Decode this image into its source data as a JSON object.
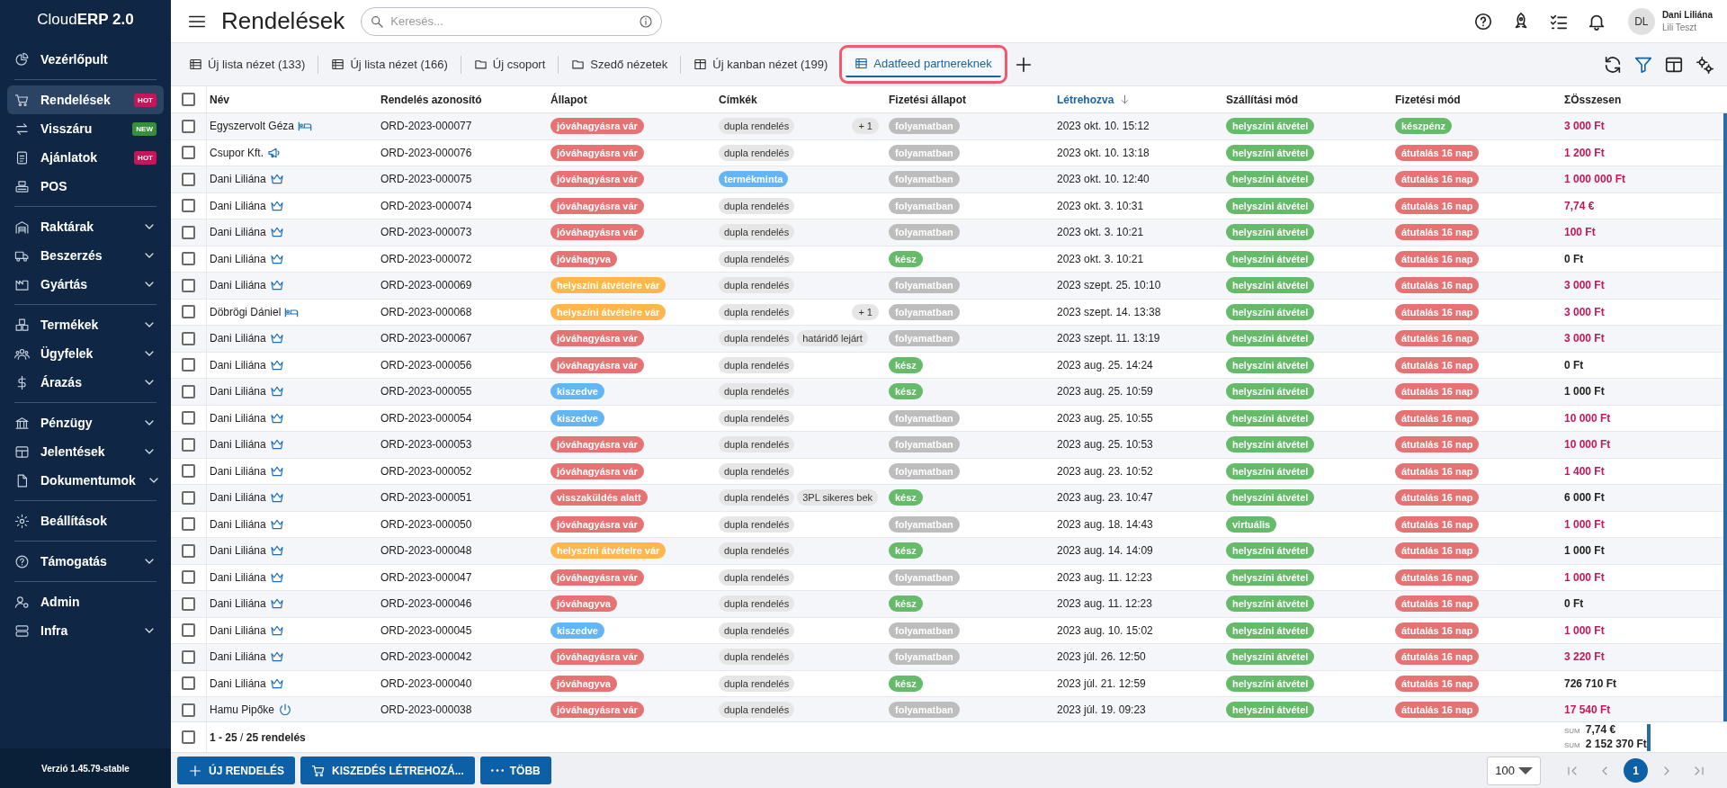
{
  "sidebar": {
    "logo": "Cloud**ERP 2.0**",
    "sections": [
      [
        {
          "label": "Vezérlőpult",
          "selected": false
        }
      ],
      [
        {
          "label": "Rendelések",
          "selected": true,
          "badge": {
            "text": "HOT",
            "color": "#c2185b"
          }
        },
        {
          "label": "Visszáru",
          "selected": false,
          "badge": {
            "text": "NEW",
            "color": "#388e3c"
          }
        },
        {
          "label": "Ajánlatok",
          "selected": false,
          "badge": {
            "text": "HOT",
            "color": "#c2185b"
          }
        },
        {
          "label": "POS",
          "selected": false
        }
      ],
      [
        {
          "label": "Raktárak",
          "selected": false,
          "expanded": false
        },
        {
          "label": "Beszerzés",
          "selected": false,
          "expanded": false
        },
        {
          "label": "Gyártás",
          "selected": false,
          "expanded": false
        }
      ],
      [
        {
          "label": "Termékek",
          "selected": false,
          "expanded": false
        },
        {
          "label": "Ügyfelek",
          "selected": false,
          "expanded": false
        },
        {
          "label": "Árazás",
          "selected": false,
          "expanded": false
        }
      ],
      [
        {
          "label": "Pénzügy",
          "selected": false,
          "expanded": false
        },
        {
          "label": "Jelentések",
          "selected": false,
          "expanded": false
        },
        {
          "label": "Dokumentumok",
          "selected": false,
          "expanded": false
        }
      ],
      [
        {
          "label": "Beállítások",
          "selected": false
        }
      ],
      [
        {
          "label": "Támogatás",
          "selected": false,
          "expanded": false
        }
      ],
      [
        {
          "label": "Admin",
          "selected": false
        },
        {
          "label": "Infra",
          "selected": false,
          "expanded": false
        }
      ]
    ],
    "version": "Verzió 1.45.79-stable"
  },
  "header": {
    "title": "Rendelések",
    "search": {
      "placeholder": "Keresés..."
    },
    "user": {
      "initials": "DL",
      "name": "Dani Liliána",
      "subtitle": "Lili Teszt"
    }
  },
  "tabs": [
    {
      "label": "Új lista nézet (133)",
      "kind": "list",
      "selected": false
    },
    {
      "label": "Új lista nézet (166)",
      "kind": "list",
      "selected": false
    },
    {
      "label": "Új csoport",
      "kind": "folder",
      "selected": false
    },
    {
      "label": "Szedő nézetek",
      "kind": "folder",
      "selected": false
    },
    {
      "label": "Új kanban nézet (199)",
      "kind": "kanban",
      "selected": false
    },
    {
      "label": "Adatfeed partnereknek",
      "kind": "list",
      "selected": true
    }
  ],
  "table": {
    "select_all": {
      "checked": false
    },
    "columns": [
      {
        "label": "Név",
        "sorted": false
      },
      {
        "label": "Rendelés azonosító",
        "sorted": false
      },
      {
        "label": "Állapot",
        "sorted": false
      },
      {
        "label": "Címkék",
        "sorted": false
      },
      {
        "label": "Fizetési állapot",
        "sorted": false
      },
      {
        "label": "Létrehozva",
        "sorted": true
      },
      {
        "label": "Szállítási mód",
        "sorted": false
      },
      {
        "label": "Fizetési mód",
        "sorted": false
      },
      {
        "label": "Összesen",
        "sorted": false,
        "prefix": "Σ"
      }
    ],
    "rows": [
      {
        "checked": false,
        "name": "Egyszervolt Géza",
        "kind": "bed",
        "id": "ORD-2023-000077",
        "status": {
          "text": "jóváhagyásra vár",
          "color": "#e57373"
        },
        "tags": [
          {
            "text": "dupla rendelés",
            "color": "#e6e6e6"
          }
        ],
        "more": "+ 1",
        "payment_status": {
          "text": "folyamatban",
          "color": "#bdbdbd"
        },
        "created": "2023 okt. 10. 15:12",
        "shipping": {
          "text": "helyszíni átvétel",
          "color": "#66bb6a"
        },
        "payment_method": {
          "text": "készpénz",
          "color": "#66bb6a"
        },
        "total": {
          "text": "3 000 Ft",
          "highlighted": true
        }
      },
      {
        "checked": false,
        "name": "Csupor Kft.",
        "kind": "megaphone",
        "id": "ORD-2023-000076",
        "status": {
          "text": "jóváhagyásra vár",
          "color": "#e57373"
        },
        "tags": [
          {
            "text": "dupla rendelés",
            "color": "#e6e6e6"
          }
        ],
        "payment_status": {
          "text": "folyamatban",
          "color": "#bdbdbd"
        },
        "created": "2023 okt. 10. 13:18",
        "shipping": {
          "text": "helyszíni átvétel",
          "color": "#66bb6a"
        },
        "payment_method": {
          "text": "átutalás 16 nap",
          "color": "#e57373"
        },
        "total": {
          "text": "1 200 Ft",
          "highlighted": true
        }
      },
      {
        "checked": false,
        "name": "Dani Liliána",
        "kind": "crown",
        "id": "ORD-2023-000075",
        "status": {
          "text": "jóváhagyásra vár",
          "color": "#e57373"
        },
        "tags": [
          {
            "text": "termékminta",
            "color": "#64b5f6"
          }
        ],
        "payment_status": {
          "text": "folyamatban",
          "color": "#bdbdbd"
        },
        "created": "2023 okt. 10. 12:40",
        "shipping": {
          "text": "helyszíni átvétel",
          "color": "#66bb6a"
        },
        "payment_method": {
          "text": "átutalás 16 nap",
          "color": "#e57373"
        },
        "total": {
          "text": "1 000 000 Ft",
          "highlighted": true
        }
      },
      {
        "checked": false,
        "name": "Dani Liliána",
        "kind": "crown",
        "id": "ORD-2023-000074",
        "status": {
          "text": "jóváhagyásra vár",
          "color": "#e57373"
        },
        "tags": [
          {
            "text": "dupla rendelés",
            "color": "#e6e6e6"
          }
        ],
        "payment_status": {
          "text": "folyamatban",
          "color": "#bdbdbd"
        },
        "created": "2023 okt. 3. 10:31",
        "shipping": {
          "text": "helyszíni átvétel",
          "color": "#66bb6a"
        },
        "payment_method": {
          "text": "átutalás 16 nap",
          "color": "#e57373"
        },
        "total": {
          "text": "7,74 €",
          "highlighted": true
        }
      },
      {
        "checked": false,
        "name": "Dani Liliána",
        "kind": "crown",
        "id": "ORD-2023-000073",
        "status": {
          "text": "jóváhagyásra vár",
          "color": "#e57373"
        },
        "tags": [
          {
            "text": "dupla rendelés",
            "color": "#e6e6e6"
          }
        ],
        "payment_status": {
          "text": "folyamatban",
          "color": "#bdbdbd"
        },
        "created": "2023 okt. 3. 10:21",
        "shipping": {
          "text": "helyszíni átvétel",
          "color": "#66bb6a"
        },
        "payment_method": {
          "text": "átutalás 16 nap",
          "color": "#e57373"
        },
        "total": {
          "text": "100 Ft",
          "highlighted": true
        }
      },
      {
        "checked": false,
        "name": "Dani Liliána",
        "kind": "crown",
        "id": "ORD-2023-000072",
        "status": {
          "text": "jóváhagyva",
          "color": "#e57373"
        },
        "tags": [
          {
            "text": "dupla rendelés",
            "color": "#e6e6e6"
          }
        ],
        "payment_status": {
          "text": "kész",
          "color": "#66bb6a"
        },
        "created": "2023 okt. 3. 10:21",
        "shipping": {
          "text": "helyszíni átvétel",
          "color": "#66bb6a"
        },
        "payment_method": {
          "text": "átutalás 16 nap",
          "color": "#e57373"
        },
        "total": {
          "text": "0 Ft",
          "highlighted": false
        }
      },
      {
        "checked": false,
        "name": "Dani Liliána",
        "kind": "crown",
        "id": "ORD-2023-000069",
        "status": {
          "text": "helyszíni átvételre vár",
          "color": "#ffb74d"
        },
        "tags": [
          {
            "text": "dupla rendelés",
            "color": "#e6e6e6"
          }
        ],
        "payment_status": {
          "text": "folyamatban",
          "color": "#bdbdbd"
        },
        "created": "2023 szept. 25. 10:10",
        "shipping": {
          "text": "helyszíni átvétel",
          "color": "#66bb6a"
        },
        "payment_method": {
          "text": "átutalás 16 nap",
          "color": "#e57373"
        },
        "total": {
          "text": "3 000 Ft",
          "highlighted": true
        }
      },
      {
        "checked": false,
        "name": "Döbrögi Dániel",
        "kind": "bed",
        "id": "ORD-2023-000068",
        "status": {
          "text": "helyszíni átvételre vár",
          "color": "#ffb74d"
        },
        "tags": [
          {
            "text": "dupla rendelés",
            "color": "#e6e6e6"
          }
        ],
        "more": "+ 1",
        "payment_status": {
          "text": "folyamatban",
          "color": "#bdbdbd"
        },
        "created": "2023 szept. 14. 13:38",
        "shipping": {
          "text": "helyszíni átvétel",
          "color": "#66bb6a"
        },
        "payment_method": {
          "text": "átutalás 16 nap",
          "color": "#e57373"
        },
        "total": {
          "text": "3 000 Ft",
          "highlighted": true
        }
      },
      {
        "checked": false,
        "name": "Dani Liliána",
        "kind": "crown",
        "id": "ORD-2023-000067",
        "status": {
          "text": "jóváhagyásra vár",
          "color": "#e57373"
        },
        "tags": [
          {
            "text": "dupla rendelés",
            "color": "#e6e6e6"
          },
          {
            "text": "határidő lejárt",
            "color": "#e6e6e6"
          }
        ],
        "payment_status": {
          "text": "folyamatban",
          "color": "#bdbdbd"
        },
        "created": "2023 szept. 11. 13:19",
        "shipping": {
          "text": "helyszíni átvétel",
          "color": "#66bb6a"
        },
        "payment_method": {
          "text": "átutalás 16 nap",
          "color": "#e57373"
        },
        "total": {
          "text": "3 000 Ft",
          "highlighted": true
        }
      },
      {
        "checked": false,
        "name": "Dani Liliána",
        "kind": "crown",
        "id": "ORD-2023-000056",
        "status": {
          "text": "jóváhagyásra vár",
          "color": "#e57373"
        },
        "tags": [
          {
            "text": "dupla rendelés",
            "color": "#e6e6e6"
          }
        ],
        "payment_status": {
          "text": "kész",
          "color": "#66bb6a"
        },
        "created": "2023 aug. 25. 14:24",
        "shipping": {
          "text": "helyszíni átvétel",
          "color": "#66bb6a"
        },
        "payment_method": {
          "text": "átutalás 16 nap",
          "color": "#e57373"
        },
        "total": {
          "text": "0 Ft",
          "highlighted": false
        }
      },
      {
        "checked": false,
        "name": "Dani Liliána",
        "kind": "crown",
        "id": "ORD-2023-000055",
        "status": {
          "text": "kiszedve",
          "color": "#64b5f6"
        },
        "tags": [
          {
            "text": "dupla rendelés",
            "color": "#e6e6e6"
          }
        ],
        "payment_status": {
          "text": "kész",
          "color": "#66bb6a"
        },
        "created": "2023 aug. 25. 10:59",
        "shipping": {
          "text": "helyszíni átvétel",
          "color": "#66bb6a"
        },
        "payment_method": {
          "text": "átutalás 16 nap",
          "color": "#e57373"
        },
        "total": {
          "text": "1 000 Ft",
          "highlighted": false
        }
      },
      {
        "checked": false,
        "name": "Dani Liliána",
        "kind": "crown",
        "id": "ORD-2023-000054",
        "status": {
          "text": "kiszedve",
          "color": "#64b5f6"
        },
        "tags": [
          {
            "text": "dupla rendelés",
            "color": "#e6e6e6"
          }
        ],
        "payment_status": {
          "text": "folyamatban",
          "color": "#bdbdbd"
        },
        "created": "2023 aug. 25. 10:55",
        "shipping": {
          "text": "helyszíni átvétel",
          "color": "#66bb6a"
        },
        "payment_method": {
          "text": "átutalás 16 nap",
          "color": "#e57373"
        },
        "total": {
          "text": "10 000 Ft",
          "highlighted": true
        }
      },
      {
        "checked": false,
        "name": "Dani Liliána",
        "kind": "crown",
        "id": "ORD-2023-000053",
        "status": {
          "text": "jóváhagyásra vár",
          "color": "#e57373"
        },
        "tags": [
          {
            "text": "dupla rendelés",
            "color": "#e6e6e6"
          }
        ],
        "payment_status": {
          "text": "folyamatban",
          "color": "#bdbdbd"
        },
        "created": "2023 aug. 25. 10:53",
        "shipping": {
          "text": "helyszíni átvétel",
          "color": "#66bb6a"
        },
        "payment_method": {
          "text": "átutalás 16 nap",
          "color": "#e57373"
        },
        "total": {
          "text": "10 000 Ft",
          "highlighted": true
        }
      },
      {
        "checked": false,
        "name": "Dani Liliána",
        "kind": "crown",
        "id": "ORD-2023-000052",
        "status": {
          "text": "jóváhagyásra vár",
          "color": "#e57373"
        },
        "tags": [
          {
            "text": "dupla rendelés",
            "color": "#e6e6e6"
          }
        ],
        "payment_status": {
          "text": "folyamatban",
          "color": "#bdbdbd"
        },
        "created": "2023 aug. 23. 10:52",
        "shipping": {
          "text": "helyszíni átvétel",
          "color": "#66bb6a"
        },
        "payment_method": {
          "text": "átutalás 16 nap",
          "color": "#e57373"
        },
        "total": {
          "text": "1 400 Ft",
          "highlighted": true
        }
      },
      {
        "checked": false,
        "name": "Dani Liliána",
        "kind": "crown",
        "id": "ORD-2023-000051",
        "status": {
          "text": "visszaküldés alatt",
          "color": "#e57373"
        },
        "tags": [
          {
            "text": "dupla rendelés",
            "color": "#e6e6e6"
          },
          {
            "text": "3PL sikeres bek",
            "color": "#e6e6e6"
          }
        ],
        "payment_status": {
          "text": "kész",
          "color": "#66bb6a"
        },
        "created": "2023 aug. 23. 10:47",
        "shipping": {
          "text": "helyszíni átvétel",
          "color": "#66bb6a"
        },
        "payment_method": {
          "text": "átutalás 16 nap",
          "color": "#e57373"
        },
        "total": {
          "text": "6 000 Ft",
          "highlighted": false
        }
      },
      {
        "checked": false,
        "name": "Dani Liliána",
        "kind": "crown",
        "id": "ORD-2023-000050",
        "status": {
          "text": "jóváhagyásra vár",
          "color": "#e57373"
        },
        "tags": [
          {
            "text": "dupla rendelés",
            "color": "#e6e6e6"
          }
        ],
        "payment_status": {
          "text": "folyamatban",
          "color": "#bdbdbd"
        },
        "created": "2023 aug. 18. 14:43",
        "shipping": {
          "text": "virtuális",
          "color": "#66bb6a"
        },
        "payment_method": {
          "text": "átutalás 16 nap",
          "color": "#e57373"
        },
        "total": {
          "text": "1 000 Ft",
          "highlighted": true
        }
      },
      {
        "checked": false,
        "name": "Dani Liliána",
        "kind": "crown",
        "id": "ORD-2023-000048",
        "status": {
          "text": "helyszíni átvételre vár",
          "color": "#ffb74d"
        },
        "tags": [
          {
            "text": "dupla rendelés",
            "color": "#e6e6e6"
          }
        ],
        "payment_status": {
          "text": "kész",
          "color": "#66bb6a"
        },
        "created": "2023 aug. 14. 14:09",
        "shipping": {
          "text": "helyszíni átvétel",
          "color": "#66bb6a"
        },
        "payment_method": {
          "text": "átutalás 16 nap",
          "color": "#e57373"
        },
        "total": {
          "text": "1 000 Ft",
          "highlighted": false
        }
      },
      {
        "checked": false,
        "name": "Dani Liliána",
        "kind": "crown",
        "id": "ORD-2023-000047",
        "status": {
          "text": "jóváhagyásra vár",
          "color": "#e57373"
        },
        "tags": [
          {
            "text": "dupla rendelés",
            "color": "#e6e6e6"
          }
        ],
        "payment_status": {
          "text": "folyamatban",
          "color": "#bdbdbd"
        },
        "created": "2023 aug. 11. 12:23",
        "shipping": {
          "text": "helyszíni átvétel",
          "color": "#66bb6a"
        },
        "payment_method": {
          "text": "átutalás 16 nap",
          "color": "#e57373"
        },
        "total": {
          "text": "1 000 Ft",
          "highlighted": true
        }
      },
      {
        "checked": false,
        "name": "Dani Liliána",
        "kind": "crown",
        "id": "ORD-2023-000046",
        "status": {
          "text": "jóváhagyva",
          "color": "#e57373"
        },
        "tags": [
          {
            "text": "dupla rendelés",
            "color": "#e6e6e6"
          }
        ],
        "payment_status": {
          "text": "kész",
          "color": "#66bb6a"
        },
        "created": "2023 aug. 11. 12:23",
        "shipping": {
          "text": "helyszíni átvétel",
          "color": "#66bb6a"
        },
        "payment_method": {
          "text": "átutalás 16 nap",
          "color": "#e57373"
        },
        "total": {
          "text": "0 Ft",
          "highlighted": false
        }
      },
      {
        "checked": false,
        "name": "Dani Liliána",
        "kind": "crown",
        "id": "ORD-2023-000045",
        "status": {
          "text": "kiszedve",
          "color": "#64b5f6"
        },
        "tags": [
          {
            "text": "dupla rendelés",
            "color": "#e6e6e6"
          }
        ],
        "payment_status": {
          "text": "folyamatban",
          "color": "#bdbdbd"
        },
        "created": "2023 aug. 10. 15:02",
        "shipping": {
          "text": "helyszíni átvétel",
          "color": "#66bb6a"
        },
        "payment_method": {
          "text": "átutalás 16 nap",
          "color": "#e57373"
        },
        "total": {
          "text": "1 000 Ft",
          "highlighted": true
        }
      },
      {
        "checked": false,
        "name": "Dani Liliána",
        "kind": "crown",
        "id": "ORD-2023-000042",
        "status": {
          "text": "jóváhagyásra vár",
          "color": "#e57373"
        },
        "tags": [
          {
            "text": "dupla rendelés",
            "color": "#e6e6e6"
          }
        ],
        "payment_status": {
          "text": "folyamatban",
          "color": "#bdbdbd"
        },
        "created": "2023 júl. 26. 12:50",
        "shipping": {
          "text": "helyszíni átvétel",
          "color": "#66bb6a"
        },
        "payment_method": {
          "text": "átutalás 16 nap",
          "color": "#e57373"
        },
        "total": {
          "text": "3 220 Ft",
          "highlighted": true
        }
      },
      {
        "checked": false,
        "name": "Dani Liliána",
        "kind": "crown",
        "id": "ORD-2023-000040",
        "status": {
          "text": "jóváhagyva",
          "color": "#e57373"
        },
        "tags": [
          {
            "text": "dupla rendelés",
            "color": "#e6e6e6"
          }
        ],
        "payment_status": {
          "text": "kész",
          "color": "#66bb6a"
        },
        "created": "2023 júl. 21. 12:59",
        "shipping": {
          "text": "helyszíni átvétel",
          "color": "#66bb6a"
        },
        "payment_method": {
          "text": "átutalás 16 nap",
          "color": "#e57373"
        },
        "total": {
          "text": "726 710 Ft",
          "highlighted": false
        }
      },
      {
        "checked": false,
        "name": "Hamu Pipőke",
        "kind": "power",
        "id": "ORD-2023-000038",
        "status": {
          "text": "jóváhagyásra vár",
          "color": "#e57373"
        },
        "tags": [
          {
            "text": "dupla rendelés",
            "color": "#e6e6e6"
          }
        ],
        "payment_status": {
          "text": "folyamatban",
          "color": "#bdbdbd"
        },
        "created": "2023 júl. 19. 09:23",
        "shipping": {
          "text": "helyszíni átvétel",
          "color": "#66bb6a"
        },
        "payment_method": {
          "text": "átutalás 16 nap",
          "color": "#e57373"
        },
        "total": {
          "text": "17 540 Ft",
          "highlighted": true
        }
      }
    ],
    "footer": {
      "checked": false,
      "count": "**1 - 25** / **25 rendelés**",
      "sums": [
        {
          "label": "SUM",
          "value": "7,74 €"
        },
        {
          "label": "SUM",
          "value": "2 152 370 Ft"
        }
      ]
    }
  },
  "actions": [
    {
      "label": "ÚJ RENDELÉS",
      "kind": "plus"
    },
    {
      "label": "KISZEDÉS LÉTREHOZÁ...",
      "kind": "cart"
    },
    {
      "label": "TÖBB",
      "kind": "dots"
    }
  ],
  "pagination": {
    "page_size": "100",
    "pages": [
      {
        "label": "1",
        "selected": true
      }
    ]
  }
}
